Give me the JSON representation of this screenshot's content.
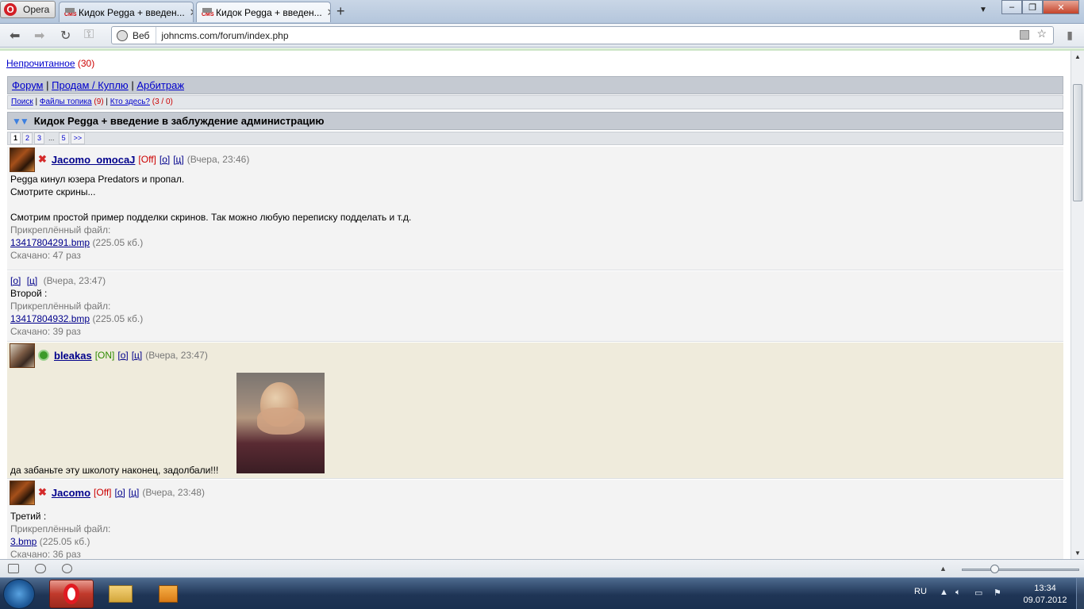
{
  "browser": {
    "menu_label": "Opera",
    "tabs": [
      {
        "title": "Кидок Pegga + введен...",
        "favicon": "cms-favicon",
        "active": false
      },
      {
        "title": "Кидок Pegga + введен...",
        "favicon": "cms-favicon",
        "active": true
      }
    ],
    "address": {
      "scheme_label": "Веб",
      "url": "johncms.com/forum/index.php"
    },
    "window_controls": {
      "minimize": "–",
      "restore": "❐",
      "close": "✕"
    }
  },
  "page": {
    "unread": {
      "label": "Непрочитанное",
      "count": "(30)"
    },
    "breadcrumbs": [
      {
        "label": "Форум"
      },
      {
        "label": "Продам / Куплю"
      },
      {
        "label": "Арбитраж"
      }
    ],
    "sublinks": {
      "search": "Поиск",
      "files": "Файлы топика",
      "files_count": "(9)",
      "who_here": "Кто здесь?",
      "who_count": "(3 / 0)"
    },
    "topic_title": "Кидок Pegga + введение в заблуждение администрацию",
    "pager": [
      "1",
      "2",
      "3",
      "...",
      "5",
      ">>"
    ],
    "posts": [
      {
        "user": "Jacomo_omocaJ",
        "status": "[Off]",
        "quote": "[о]",
        "cite": "[ц]",
        "time": "(Вчера, 23:46)",
        "lines": [
          "Pegga кинул юзера Predators и пропал.",
          "Смотрите скрины...",
          "",
          "Смотрим простой пример подделки скринов. Так можно любую переписку подделать и т.д."
        ],
        "attach_label": "Прикреплённый файл:",
        "file": "13417804291.bmp",
        "size": "(225.05 кб.)",
        "downloads": "Скачано: 47 раз"
      },
      {
        "quote": "[о]",
        "cite": "[ц]",
        "time": "(Вчера, 23:47)",
        "lines": [
          "Второй :"
        ],
        "attach_label": "Прикреплённый файл:",
        "file": "13417804932.bmp",
        "size": "(225.05 кб.)",
        "downloads": "Скачано: 39 раз"
      },
      {
        "user": "bleakas",
        "status": "[ON]",
        "quote": "[о]",
        "cite": "[ц]",
        "time": "(Вчера, 23:47)",
        "lines": [
          "да забаньте эту школоту наконец, задолбали!!!"
        ]
      },
      {
        "user": "Jacomo",
        "status": "[Off]",
        "quote": "[о]",
        "cite": "[ц]",
        "time": "(Вчера, 23:48)",
        "lines": [
          "Третий :"
        ],
        "attach_label": "Прикреплённый файл:",
        "file": "3.bmp",
        "size": "(225.05 кб.)",
        "downloads": "Скачано: 36 раз"
      }
    ]
  },
  "taskbar": {
    "lang": "RU",
    "time": "13:34",
    "date": "09.07.2012"
  }
}
